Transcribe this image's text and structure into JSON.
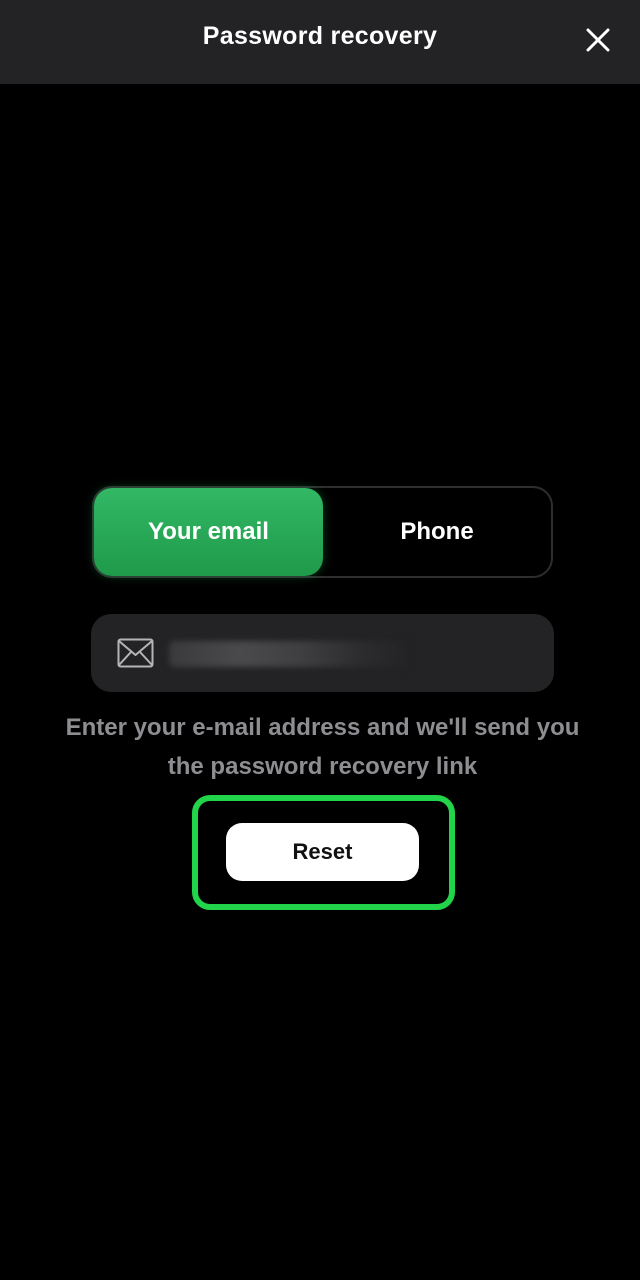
{
  "header": {
    "title": "Password recovery",
    "close_icon": "close-icon"
  },
  "tabs": [
    {
      "label": "Your email",
      "active": true
    },
    {
      "label": "Phone",
      "active": false
    }
  ],
  "email_field": {
    "icon": "mail-icon",
    "value": "",
    "value_obscured": true
  },
  "hint": "Enter your e-mail address and we'll send you the password recovery link",
  "reset_button": {
    "label": "Reset"
  },
  "colors": {
    "background": "#000000",
    "header_bg": "#232325",
    "accent_green": "#2aae5a",
    "highlight_green": "#22d449",
    "hint_text": "#8e8e92",
    "field_bg": "#232325"
  }
}
